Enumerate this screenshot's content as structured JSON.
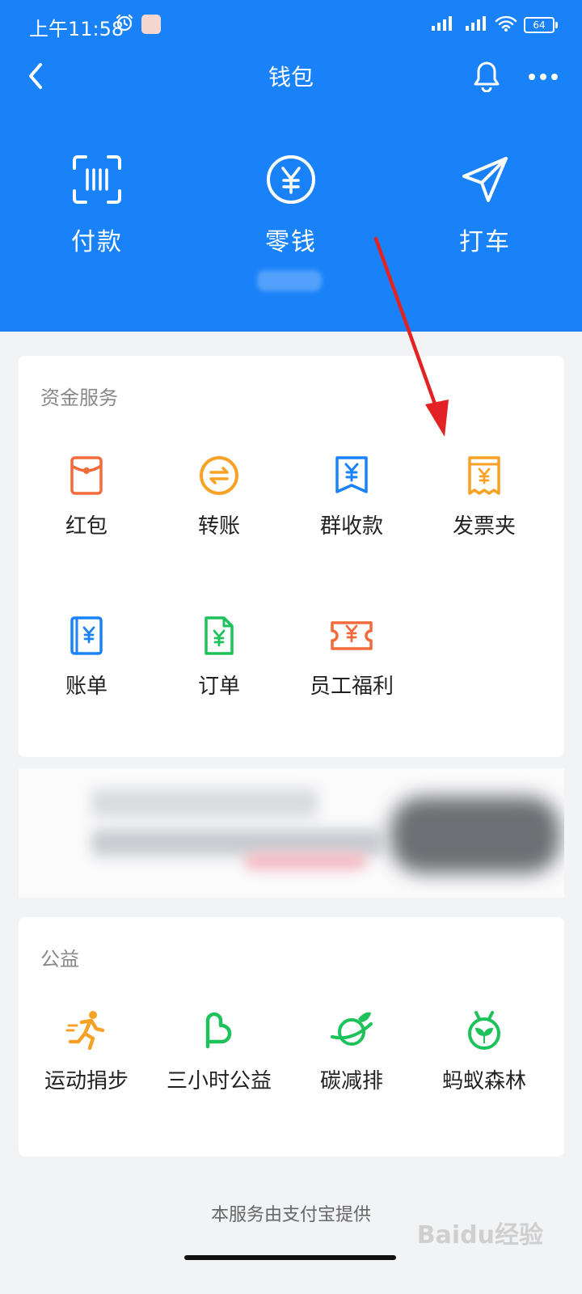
{
  "status_bar": {
    "time": "上午11:58",
    "battery": "64"
  },
  "header": {
    "title": "钱包"
  },
  "top_actions": [
    {
      "label": "付款",
      "icon": "scan-pay-icon"
    },
    {
      "label": "零钱",
      "icon": "yuan-coin-icon"
    },
    {
      "label": "打车",
      "icon": "paper-plane-icon"
    }
  ],
  "funds_card": {
    "title": "资金服务",
    "items": [
      {
        "label": "红包",
        "icon": "red-envelope-icon",
        "color": "#f16b3b"
      },
      {
        "label": "转账",
        "icon": "transfer-icon",
        "color": "#f7a226"
      },
      {
        "label": "群收款",
        "icon": "group-collect-icon",
        "color": "#1a82f9"
      },
      {
        "label": "发票夹",
        "icon": "invoice-folder-icon",
        "color": "#f7a226"
      },
      {
        "label": "账单",
        "icon": "bill-icon",
        "color": "#1a82f9"
      },
      {
        "label": "订单",
        "icon": "order-icon",
        "color": "#1ec25a"
      },
      {
        "label": "员工福利",
        "icon": "employee-welfare-icon",
        "color": "#f16b3b"
      }
    ]
  },
  "charity_card": {
    "title": "公益",
    "items": [
      {
        "label": "运动捐步",
        "icon": "running-icon",
        "color": "#f7a226"
      },
      {
        "label": "三小时公益",
        "icon": "heart-icon",
        "color": "#1ec25a"
      },
      {
        "label": "碳减排",
        "icon": "planet-leaf-icon",
        "color": "#1ec25a"
      },
      {
        "label": "蚂蚁森林",
        "icon": "sprout-icon",
        "color": "#1ec25a"
      }
    ]
  },
  "footer": {
    "text": "本服务由支付宝提供"
  },
  "watermark": {
    "text": "Baidu经验"
  },
  "colors": {
    "primary": "#1a82f9",
    "annotation_arrow": "#e32323"
  }
}
